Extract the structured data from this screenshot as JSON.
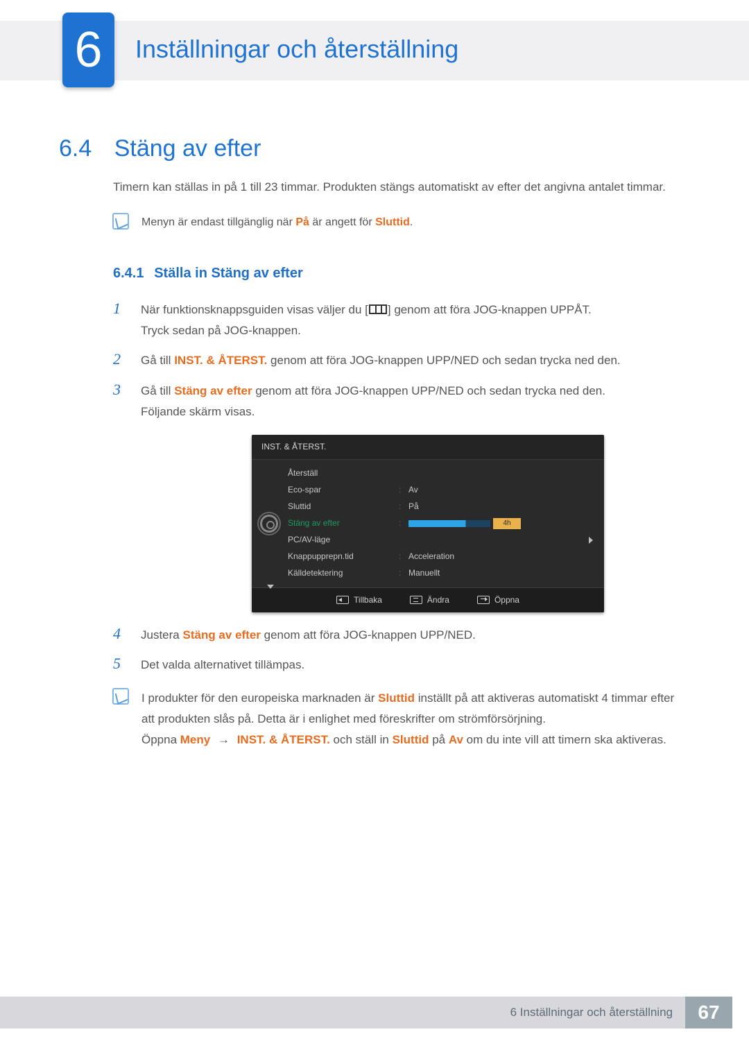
{
  "chapter": {
    "number": "6",
    "title": "Inställningar och återställning"
  },
  "section": {
    "number": "6.4",
    "title": "Stäng av efter"
  },
  "intro": "Timern kan ställas in på 1 till 23 timmar. Produkten stängs automatiskt av efter det angivna antalet timmar.",
  "note1": {
    "pre": "Menyn är endast tillgänglig när ",
    "em1": "På",
    "mid": " är angett för ",
    "em2": "Sluttid",
    "post": "."
  },
  "subsection": {
    "number": "6.4.1",
    "title": "Ställa in Stäng av efter"
  },
  "steps": {
    "s1_a": "När funktionsknappsguiden visas väljer du [",
    "s1_b": "] genom att föra JOG-knappen UPPÅT.",
    "s1_c": "Tryck sedan på JOG-knappen.",
    "s2_a": "Gå till ",
    "s2_em": "INST. & ÅTERST.",
    "s2_b": " genom att föra JOG-knappen UPP/NED och sedan trycka ned den.",
    "s3_a": "Gå till ",
    "s3_em": "Stäng av efter",
    "s3_b": " genom att föra JOG-knappen UPP/NED och sedan trycka ned den.",
    "s3_c": "Följande skärm visas.",
    "s4_a": "Justera ",
    "s4_em": "Stäng av efter",
    "s4_b": " genom att föra JOG-knappen UPP/NED.",
    "s5": "Det valda alternativet tillämpas."
  },
  "osd": {
    "title": "INST. & ÅTERST.",
    "rows": [
      {
        "label": "Återställ",
        "value": ""
      },
      {
        "label": "Eco-spar",
        "value": "Av"
      },
      {
        "label": "Sluttid",
        "value": "På"
      },
      {
        "label": "Stäng av efter",
        "value": "4h",
        "selected": true,
        "slider": true
      },
      {
        "label": "PC/AV-läge",
        "value": "",
        "caret": true
      },
      {
        "label": "Knappupprepn.tid",
        "value": "Acceleration"
      },
      {
        "label": "Källdetektering",
        "value": "Manuellt"
      }
    ],
    "footer": {
      "back": "Tillbaka",
      "change": "Ändra",
      "open": "Öppna"
    }
  },
  "note2": {
    "l1_a": "I produkter för den europeiska marknaden är ",
    "l1_em": "Sluttid",
    "l1_b": " inställt på att aktiveras automatiskt 4 timmar efter att produkten slås på. Detta är i enlighet med föreskrifter om strömförsörjning.",
    "l2_a": "Öppna ",
    "l2_em1": "Meny",
    "l2_b": " ",
    "arrow": "→",
    "l2_c": " ",
    "l2_em2": "INST. & ÅTERST.",
    "l2_d": " och ställ in ",
    "l2_em3": "Sluttid",
    "l2_e": " på ",
    "l2_em4": "Av",
    "l2_f": " om du inte vill att timern ska aktiveras."
  },
  "footer": {
    "text": "6 Inställningar och återställning",
    "page": "67"
  }
}
